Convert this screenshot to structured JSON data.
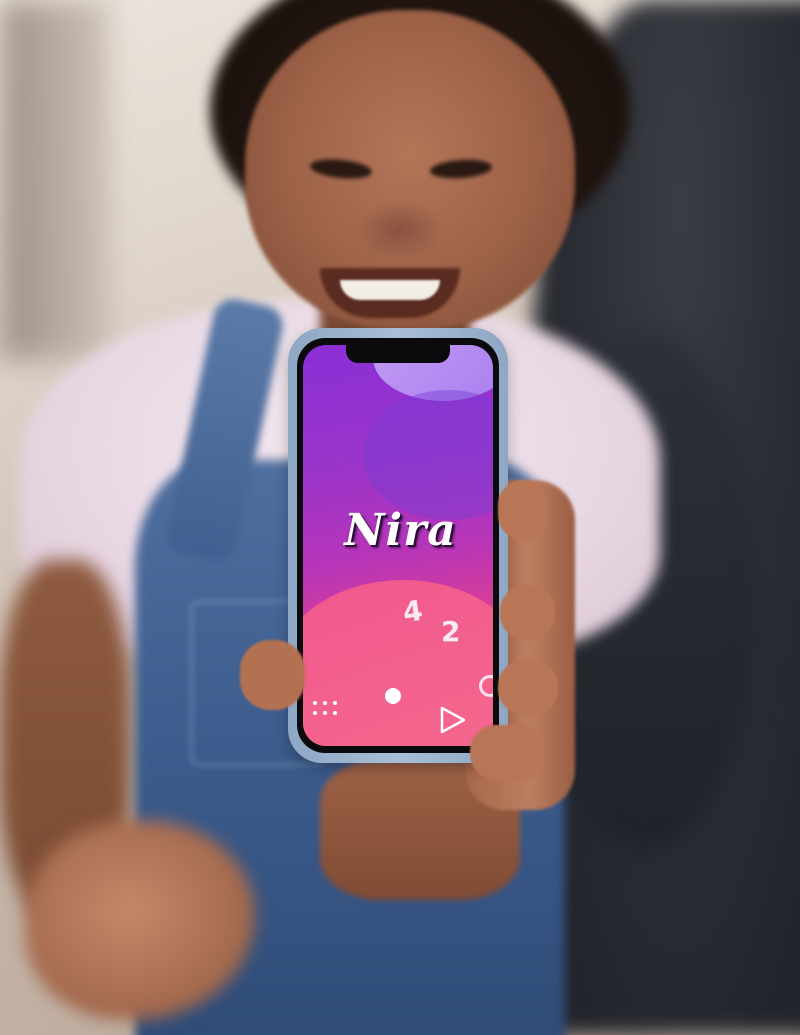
{
  "photo": {
    "subject": "",
    "colors": {
      "shirt": "#eadbe6",
      "overalls": "#3d5d8e",
      "skin": "#a76c50",
      "phone_case": "#9fb5cf"
    }
  },
  "phone": {
    "app": {
      "title": "Nira",
      "numbers": [
        "4",
        "2"
      ],
      "icons": [
        "dot-icon",
        "ring-icon",
        "dot-grid-icon",
        "play-triangle-icon"
      ],
      "colors": {
        "gradient_top": "#8a2fd6",
        "gradient_mid": "#b735b8",
        "gradient_bottom": "#f4528a",
        "blob_top": "#c49df3",
        "accent_white": "#ffffff"
      }
    }
  }
}
